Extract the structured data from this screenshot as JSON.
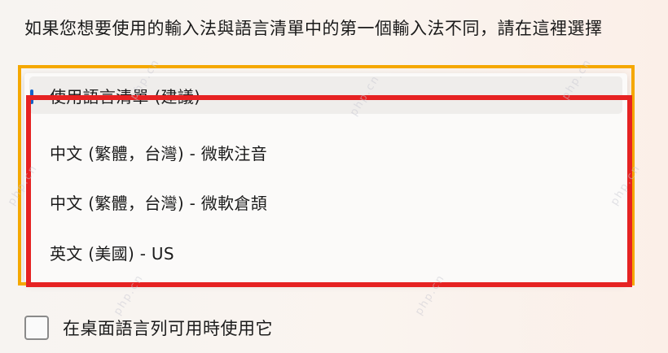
{
  "instruction": "如果您想要使用的輸入法與語言清單中的第一個輸入法不同，請在這裡選擇",
  "dropdown": {
    "options": [
      {
        "label": "使用語言清單 (建議)",
        "selected": true
      },
      {
        "label": "中文 (繁體，台灣) - 微軟注音",
        "selected": false
      },
      {
        "label": "中文 (繁體，台灣) - 微軟倉頡",
        "selected": false
      },
      {
        "label": "英文 (美國) - US",
        "selected": false
      }
    ]
  },
  "checkbox": {
    "label": "在桌面語言列可用時使用它",
    "checked": false
  },
  "watermark": "php.cn",
  "colors": {
    "annotation_orange": "#f5a800",
    "annotation_red": "#e62222",
    "selection_accent": "#1562c9"
  }
}
